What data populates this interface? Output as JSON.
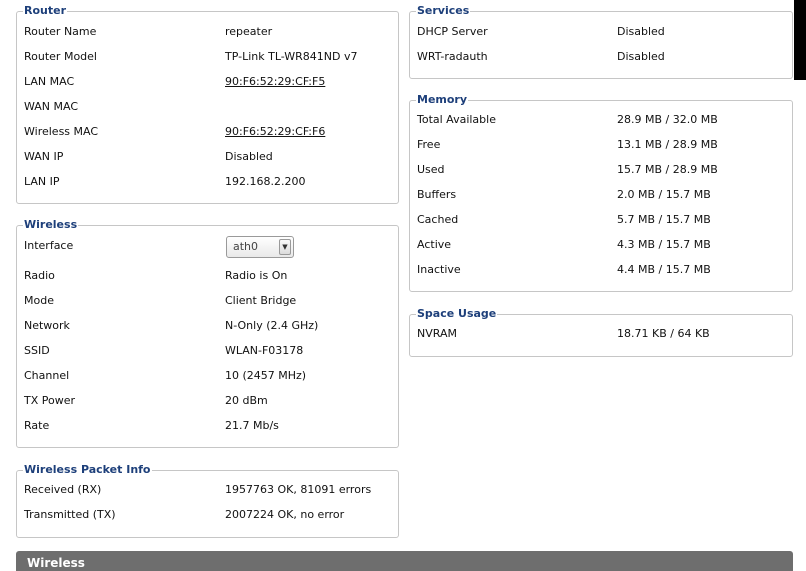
{
  "router": {
    "title": "Router",
    "rows": [
      {
        "label": "Router Name",
        "value": "repeater"
      },
      {
        "label": "Router Model",
        "value": "TP-Link TL-WR841ND v7"
      },
      {
        "label": "LAN MAC",
        "value": "90:F6:52:29:CF:F5"
      },
      {
        "label": "WAN MAC",
        "value": ""
      },
      {
        "label": "Wireless MAC",
        "value": "90:F6:52:29:CF:F6"
      },
      {
        "label": "WAN IP",
        "value": "Disabled"
      },
      {
        "label": "LAN IP",
        "value": "192.168.2.200"
      }
    ]
  },
  "wireless": {
    "title": "Wireless",
    "interface_label": "Interface",
    "interface_value": "ath0",
    "rows": [
      {
        "label": "Radio",
        "value": "Radio is On"
      },
      {
        "label": "Mode",
        "value": "Client Bridge"
      },
      {
        "label": "Network",
        "value": "N-Only (2.4 GHz)"
      },
      {
        "label": "SSID",
        "value": "WLAN-F03178"
      },
      {
        "label": "Channel",
        "value": "10 (2457 MHz)"
      },
      {
        "label": "TX Power",
        "value": "20 dBm"
      },
      {
        "label": "Rate",
        "value": "21.7 Mb/s"
      }
    ]
  },
  "packet_info": {
    "title": "Wireless Packet Info",
    "rows": [
      {
        "label": "Received (RX)",
        "value": "1957763 OK, 81091 errors"
      },
      {
        "label": "Transmitted (TX)",
        "value": "2007224 OK, no error"
      }
    ]
  },
  "services": {
    "title": "Services",
    "rows": [
      {
        "label": "DHCP Server",
        "value": "Disabled"
      },
      {
        "label": "WRT-radauth",
        "value": "Disabled"
      }
    ]
  },
  "memory": {
    "title": "Memory",
    "rows": [
      {
        "label": "Total Available",
        "value": "28.9 MB / 32.0 MB"
      },
      {
        "label": "Free",
        "value": "13.1 MB / 28.9 MB"
      },
      {
        "label": "Used",
        "value": "15.7 MB / 28.9 MB"
      },
      {
        "label": "Buffers",
        "value": "2.0 MB / 15.7 MB"
      },
      {
        "label": "Cached",
        "value": "5.7 MB / 15.7 MB"
      },
      {
        "label": "Active",
        "value": "4.3 MB / 15.7 MB"
      },
      {
        "label": "Inactive",
        "value": "4.4 MB / 15.7 MB"
      }
    ]
  },
  "space_usage": {
    "title": "Space Usage",
    "rows": [
      {
        "label": "NVRAM",
        "value": "18.71 KB / 64 KB"
      }
    ]
  },
  "bottom_bar": {
    "title": "Wireless"
  },
  "colors": {
    "legend_text": "#1d3f7a",
    "fieldset_border": "#c6c6c6",
    "bottom_bar": "#6e6e6e"
  },
  "icons": {
    "select_arrow": "chevron-down-icon"
  }
}
